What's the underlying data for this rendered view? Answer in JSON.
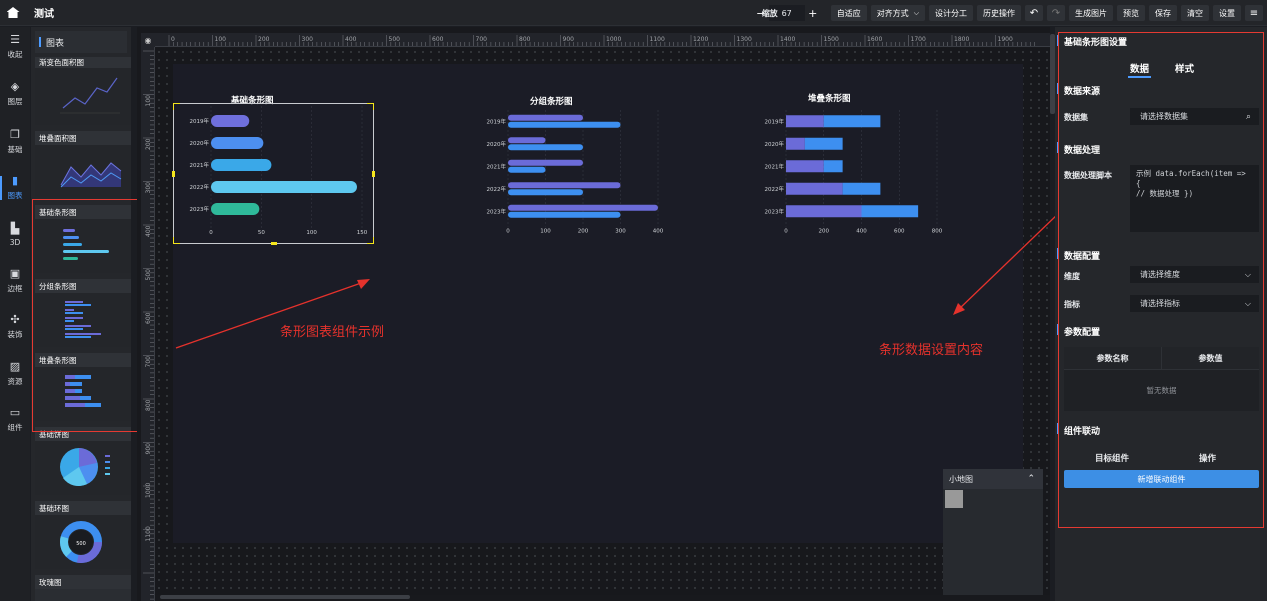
{
  "app": {
    "title": "测试"
  },
  "toolbar": {
    "zoom_label": "缩放",
    "zoom_value": "67",
    "buttons": {
      "fit": "自适应",
      "align": "对齐方式",
      "design": "设计分工",
      "history": "历史操作",
      "genimg": "生成图片",
      "preview": "预览",
      "save": "保存",
      "clear": "清空",
      "settings": "设置"
    }
  },
  "nav": [
    {
      "icon": "collapse-icon",
      "glyph": "☰",
      "label": "收起"
    },
    {
      "icon": "layers-icon",
      "glyph": "◈",
      "label": "图层"
    },
    {
      "icon": "basic-icon",
      "glyph": "❐",
      "label": "基础"
    },
    {
      "icon": "chart-icon",
      "glyph": "▮",
      "label": "图表"
    },
    {
      "icon": "3d-icon",
      "glyph": "▙",
      "label": "3D"
    },
    {
      "icon": "border-icon",
      "glyph": "▣",
      "label": "边框"
    },
    {
      "icon": "decor-icon",
      "glyph": "✣",
      "label": "装饰"
    },
    {
      "icon": "resource-icon",
      "glyph": "▨",
      "label": "资源"
    },
    {
      "icon": "component-icon",
      "glyph": "▭",
      "label": "组件"
    }
  ],
  "panel": {
    "title": "图表",
    "cards": [
      "渐变色面积图",
      "堆叠面积图",
      "基础条形图",
      "分组条形图",
      "堆叠条形图",
      "基础饼图",
      "基础环图",
      "玫瑰图"
    ],
    "donut_number": "500"
  },
  "ruler_ticks": [
    "0",
    "100",
    "200",
    "300",
    "400",
    "500",
    "600",
    "700",
    "800",
    "900",
    "1000",
    "1100",
    "1200",
    "1300",
    "1400",
    "1500",
    "1600",
    "1700",
    "1800",
    "1900"
  ],
  "ruler_left_ticks": [
    "100",
    "200",
    "300",
    "400",
    "500",
    "600",
    "700",
    "800",
    "900",
    "1000",
    "1100"
  ],
  "annotations": {
    "chart_example": "条形图表组件示例",
    "data_settings": "条形数据设置内容"
  },
  "minimap": {
    "title": "小地图"
  },
  "chart_data": [
    {
      "type": "bar",
      "title": "基础条形图",
      "orientation": "horizontal",
      "categories": [
        "2019年",
        "2020年",
        "2021年",
        "2022年",
        "2023年"
      ],
      "values": [
        38,
        52,
        60,
        145,
        48
      ],
      "colors": [
        "#6f6fdc",
        "#4d8ff0",
        "#3aa8e8",
        "#5ec8ef",
        "#2fb99a"
      ],
      "xlim": [
        0,
        150
      ],
      "xticks": [
        "0",
        "50",
        "100",
        "150"
      ]
    },
    {
      "type": "bar",
      "title": "分组条形图",
      "orientation": "horizontal",
      "categories": [
        "2019年",
        "2020年",
        "2021年",
        "2022年",
        "2023年"
      ],
      "series": [
        {
          "values": [
            200,
            100,
            200,
            300,
            400
          ],
          "color": "#6b6bd8"
        },
        {
          "values": [
            300,
            200,
            100,
            200,
            300
          ],
          "color": "#3d8ff0"
        }
      ],
      "xlim": [
        0,
        400
      ],
      "xticks": [
        "0",
        "100",
        "200",
        "300",
        "400"
      ]
    },
    {
      "type": "bar",
      "stacked": true,
      "title": "堆叠条形图",
      "orientation": "horizontal",
      "categories": [
        "2019年",
        "2020年",
        "2021年",
        "2022年",
        "2023年"
      ],
      "series": [
        {
          "values": [
            200,
            100,
            200,
            300,
            400
          ],
          "color": "#6b6bd8"
        },
        {
          "values": [
            300,
            200,
            100,
            200,
            300
          ],
          "color": "#3d8ff0"
        }
      ],
      "xlim": [
        0,
        800
      ],
      "xticks": [
        "0",
        "200",
        "400",
        "600",
        "800"
      ]
    }
  ],
  "right_panel": {
    "title": "基础条形图设置",
    "tabs": [
      "数据",
      "样式"
    ],
    "source_section": "数据来源",
    "dataset_label": "数据集",
    "dataset_placeholder": "请选择数据集",
    "process_section": "数据处理",
    "script_label": "数据处理脚本",
    "script_line1": "示例 data.forEach(item => {",
    "script_line2": "  // 数据处理 })",
    "config_section": "数据配置",
    "dimension_label": "维度",
    "dimension_placeholder": "请选择维度",
    "metric_label": "指标",
    "metric_placeholder": "请选择指标",
    "param_section": "参数配置",
    "param_col1": "参数名称",
    "param_col2": "参数值",
    "empty_text": "暂无数据",
    "link_section": "组件联动",
    "link_col1": "目标组件",
    "link_col2": "操作",
    "add_link": "新增联动组件"
  }
}
